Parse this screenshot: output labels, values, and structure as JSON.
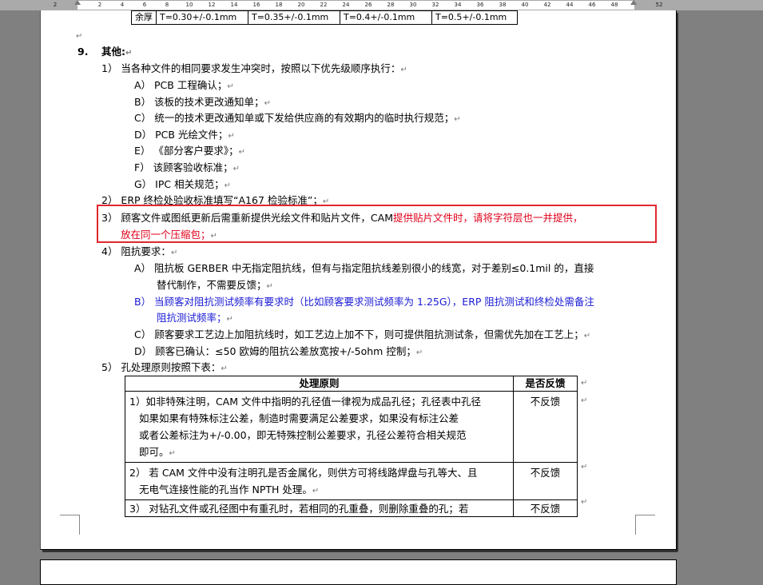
{
  "ruler": {
    "ticks": [
      "2",
      "",
      "2",
      "4",
      "6",
      "8",
      "10",
      "12",
      "14",
      "16",
      "18",
      "20",
      "22",
      "24",
      "26",
      "28",
      "30",
      "32",
      "34",
      "36",
      "38",
      "40",
      "42",
      "44",
      "46",
      "48",
      "",
      "52"
    ]
  },
  "top_table": [
    "余厚",
    "T=0.30+/-0.1mm",
    "T=0.35+/-0.1mm",
    "T=0.4+/-0.1mm",
    "T=0.5+/-0.1mm"
  ],
  "section": {
    "number": "9.",
    "title": "其他:"
  },
  "items": {
    "i1": "1） 当各种文件的相同要求发生冲突时，按照以下优先级顺序执行：",
    "i1_subs": [
      "A） PCB 工程确认；",
      "B） 该板的技术更改通知单；",
      "C） 统一的技术更改通知单或下发给供应商的有效期内的临时执行规范；",
      "D） PCB 光绘文件；",
      "E） 《部分客户要求》；",
      "F） 该顾客验收标准；",
      "G） IPC 相关规范；"
    ],
    "i2": "2） ERP 终检处验收标准填写“A167 检验标准”；",
    "i3_black": "3） 顾客文件或图纸更新后需重新提供光绘文件和贴片文件，CAM",
    "i3_red": "提供贴片文件时，请将字符层也一并提供，",
    "i3_red2": "放在同一个压缩包；",
    "i4": "4） 阻抗要求：",
    "i4_a1": "A） 阻抗板 GERBER 中无指定阻抗线，但有与指定阻抗线差别很小的线宽，对于差别≤0.1mil 的，直接",
    "i4_a2": "替代制作，不需要反馈；",
    "i4_b1": "B） 当顾客对阻抗测试频率有要求时（比如顾客要求测试频率为 1.25G），ERP 阻抗测试和终检处需备注",
    "i4_b2": "阻抗测试频率；",
    "i4_c": "C） 顾客要求工艺边上加阻抗线时，如工艺边上加不下，则可提供阻抗测试条，但需优先加在工艺上；",
    "i4_d": "D） 顾客已确认：≤50 欧姆的阻抗公差放宽按+/-5ohm 控制；",
    "i5": "5） 孔处理原则按照下表："
  },
  "hole_table": {
    "headers": [
      "处理原则",
      "是否反馈"
    ],
    "rows": [
      {
        "lines": [
          "1）如非特殊注明，CAM 文件中指明的孔径值一律视为成品孔径；孔径表中孔径",
          "如果如果有特殊标注公差，制造时需要满足公差要求，如果没有标注公差",
          "或者公差标注为+/-0.00，即无特殊控制公差要求，孔径公差符合相关规范",
          "即可。"
        ],
        "feedback": "不反馈"
      },
      {
        "lines": [
          "2） 若 CAM 文件中没有注明孔是否金属化，则供方可将线路焊盘与孔等大、且",
          "无电气连接性能的孔当作 NPTH 处理。"
        ],
        "feedback": "不反馈"
      },
      {
        "lines": [
          "3） 对钻孔文件或孔径图中有重孔时，若相同的孔重叠，则删除重叠的孔；若"
        ],
        "feedback": "不反馈"
      }
    ]
  },
  "marks": {
    "para": "↵",
    "cell": "↵"
  },
  "colors": {
    "highlight_border": "#e0282e",
    "red_text": "#e0001a",
    "blue_text": "#1a1ad6"
  }
}
